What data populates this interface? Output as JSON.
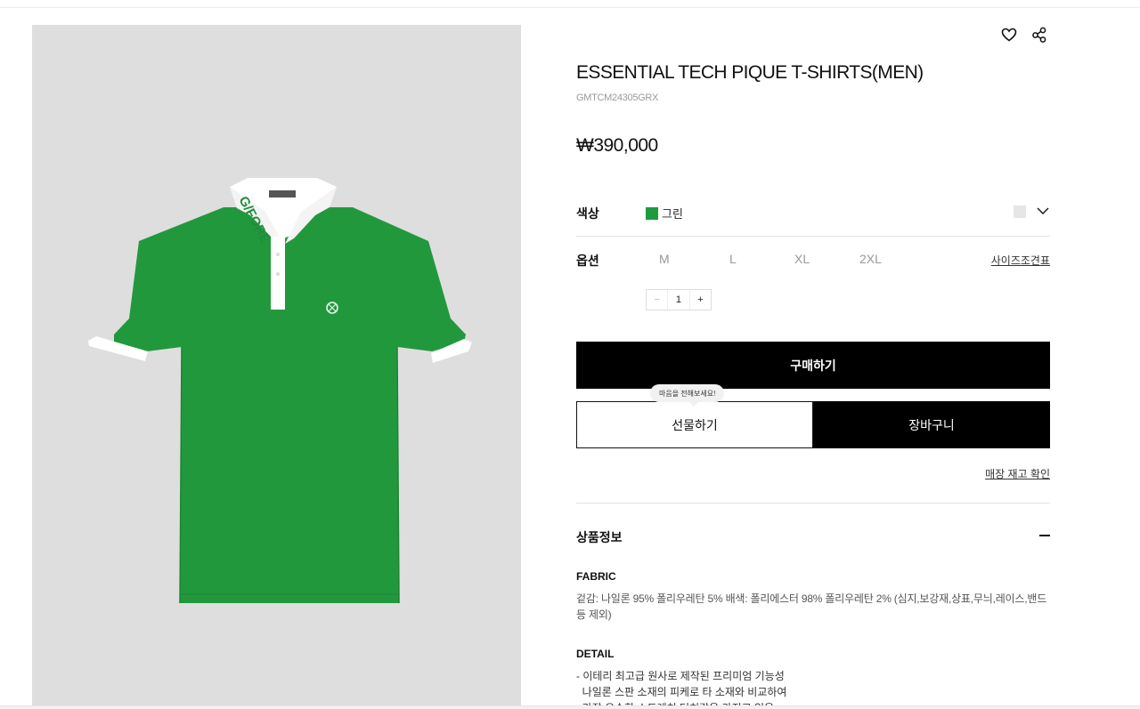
{
  "product": {
    "title": "ESSENTIAL TECH PIQUE T-SHIRTS(MEN)",
    "sku": "GMTCM24305GRX",
    "price": "₩390,000",
    "image": {
      "alt": "Green polo shirt with white collar",
      "collar_logo": "G/FORE",
      "colors": {
        "body": "#22983d",
        "collar": "#ffffff",
        "background": "#dedede"
      }
    }
  },
  "color": {
    "label": "색상",
    "value": "그린",
    "swatch": "#1f9a3e"
  },
  "options": {
    "label": "옵션",
    "sizes": [
      "M",
      "L",
      "XL",
      "2XL"
    ],
    "size_chart": "사이즈조견표",
    "quantity": {
      "minus": "−",
      "value": "1",
      "plus": "+"
    }
  },
  "actions": {
    "buy": "구매하기",
    "tooltip": "마음을 전해보세요!",
    "gift": "선물하기",
    "cart": "장바구니",
    "store_stock": "매장 재고 확인"
  },
  "info_section": {
    "title": "상품정보",
    "fabric_heading": "FABRIC",
    "fabric_text": "겉감: 나일론 95% 폴리우레탄 5% 배색: 폴리에스터 98% 폴리우레탄 2% (심지,보강재,상표,무늬,레이스,밴드 등 제외)",
    "detail_heading": "DETAIL",
    "detail_lines": [
      "- 이테리 최고급 원사로 제작된 프리미엄 기능성",
      "  나일론 스판 소재의 피케로 타 소재와 비교하여",
      "  가장 우수한 스트레치 터치감을 가지고 있음"
    ]
  },
  "icons": [
    "heart-icon",
    "share-icon",
    "chevron-down-icon",
    "minus-icon"
  ]
}
